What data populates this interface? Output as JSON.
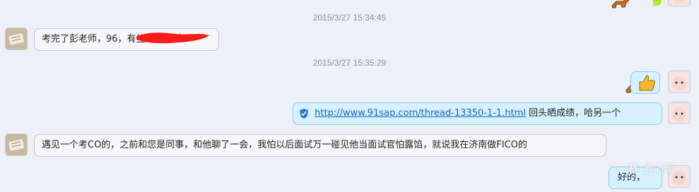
{
  "messages": [
    {
      "timestamp": "2015/3/27 15:34:45",
      "text": "考完了彭老师，96，有些题没见过"
    },
    {
      "timestamp": "2015/3/27 15:35:29"
    },
    {
      "link": "http://www.91sap.com/thread-13350-1-1.html",
      "text": "回头晒成绩，哈另一个"
    },
    {
      "text": "遇见一个考CO的，之前和您是同事，和他聊了一会，我怕以后面试万一碰见他当面试官怕露馅，就说我在济南做FICO的"
    },
    {
      "text": "好的，"
    }
  ],
  "watermark": "赛跑网",
  "colors": {
    "background": "#eef0f7",
    "incoming_bubble": "#f7f7f9",
    "outgoing_bubble": "#d6f1fd",
    "link": "#1a62c5"
  },
  "icons": [
    "avatar-book",
    "avatar-baby",
    "horse-sticker",
    "thumbs-up",
    "shield-check"
  ]
}
